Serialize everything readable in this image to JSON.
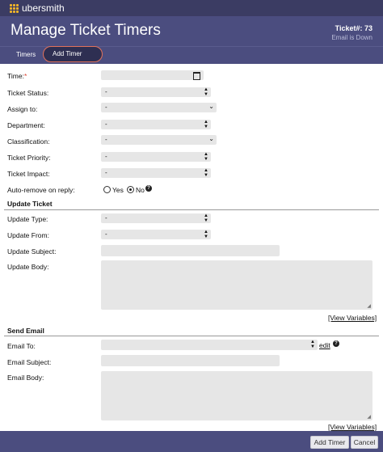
{
  "app": {
    "brand": "ubersmith"
  },
  "header": {
    "title": "Manage Ticket Timers",
    "ticket_number": "Ticket#: 73",
    "email_status": "Email is Down"
  },
  "tabs": [
    {
      "label": "Timers"
    },
    {
      "label": "Add Timer"
    }
  ],
  "form": {
    "time_label": "Time:",
    "time_required": "*",
    "ticket_status_label": "Ticket Status:",
    "ticket_status_value": "-",
    "assign_to_label": "Assign to:",
    "assign_to_value": "-",
    "department_label": "Department:",
    "department_value": "-",
    "classification_label": "Classification:",
    "classification_value": "-",
    "priority_label": "Ticket Priority:",
    "priority_value": "-",
    "impact_label": "Ticket Impact:",
    "impact_value": "-",
    "auto_remove_label": "Auto-remove on reply:",
    "yes_label": "Yes",
    "no_label": "No",
    "auto_remove_selected": "No"
  },
  "update_ticket": {
    "heading": "Update Ticket",
    "type_label": "Update Type:",
    "type_value": "-",
    "from_label": "Update From:",
    "from_value": "-",
    "subject_label": "Update Subject:",
    "subject_value": "",
    "body_label": "Update Body:",
    "body_value": "",
    "view_variables": "[View Variables]"
  },
  "send_email": {
    "heading": "Send Email",
    "to_label": "Email To:",
    "to_value": "",
    "edit_link": "edit",
    "subject_label": "Email Subject:",
    "subject_value": "",
    "body_label": "Email Body:",
    "body_value": "",
    "view_variables": "[View Variables]"
  },
  "footer": {
    "add_button": "Add Timer",
    "cancel_button": "Cancel"
  },
  "colors": {
    "topbar": "#3b3c63",
    "header": "#4b4d7f",
    "logo": "#f0b429",
    "tab_highlight": "#e2725b",
    "field_bg": "#e6e6e6"
  },
  "icons": [
    "logo-grid-icon",
    "calendar-icon",
    "updown-arrow-icon",
    "chevron-down-icon",
    "help-icon",
    "resize-handle-icon"
  ]
}
